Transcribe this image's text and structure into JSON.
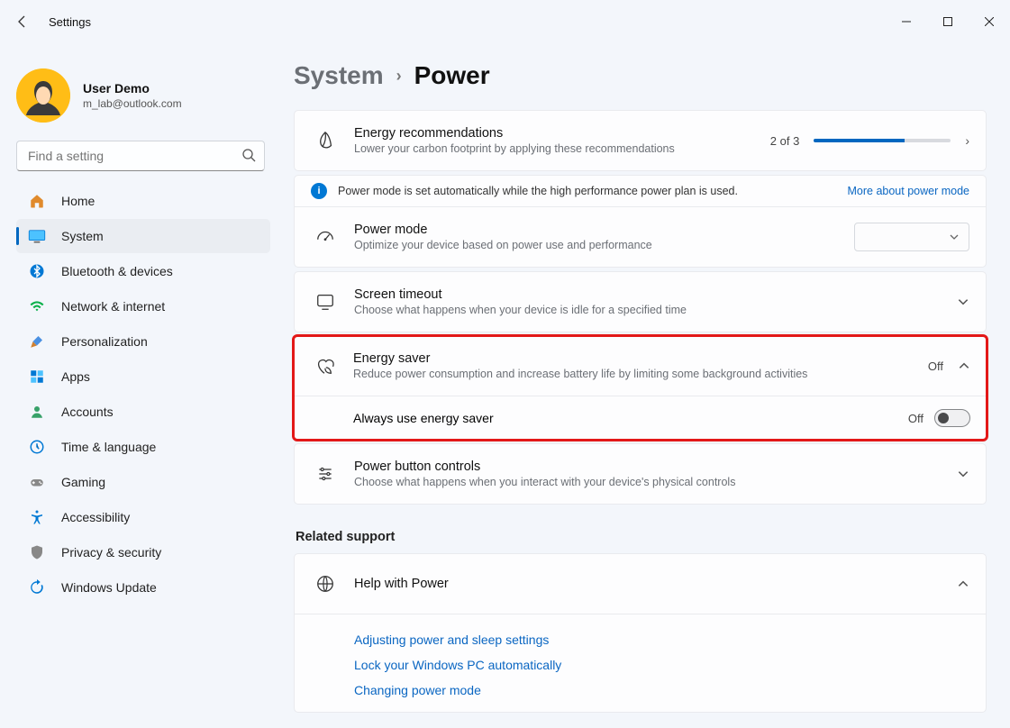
{
  "window": {
    "title": "Settings"
  },
  "user": {
    "name": "User Demo",
    "email": "m_lab@outlook.com"
  },
  "search": {
    "placeholder": "Find a setting"
  },
  "nav": [
    {
      "icon": "home",
      "label": "Home"
    },
    {
      "icon": "system",
      "label": "System",
      "selected": true
    },
    {
      "icon": "bluetooth",
      "label": "Bluetooth & devices"
    },
    {
      "icon": "network",
      "label": "Network & internet"
    },
    {
      "icon": "personalization",
      "label": "Personalization"
    },
    {
      "icon": "apps",
      "label": "Apps"
    },
    {
      "icon": "accounts",
      "label": "Accounts"
    },
    {
      "icon": "time",
      "label": "Time & language"
    },
    {
      "icon": "gaming",
      "label": "Gaming"
    },
    {
      "icon": "accessibility",
      "label": "Accessibility"
    },
    {
      "icon": "privacy",
      "label": "Privacy & security"
    },
    {
      "icon": "update",
      "label": "Windows Update"
    }
  ],
  "breadcrumb": {
    "parent": "System",
    "current": "Power"
  },
  "energy": {
    "title": "Energy recommendations",
    "sub": "Lower your carbon footprint by applying these recommendations",
    "count": "2 of 3",
    "progress_pct": 66
  },
  "info": {
    "text": "Power mode is set automatically while the high performance power plan is used.",
    "link": "More about power mode"
  },
  "powermode": {
    "title": "Power mode",
    "sub": "Optimize your device based on power use and performance",
    "selected": ""
  },
  "screen": {
    "title": "Screen timeout",
    "sub": "Choose what happens when your device is idle for a specified time"
  },
  "saver": {
    "title": "Energy saver",
    "sub": "Reduce power consumption and increase battery life by limiting some background activities",
    "state": "Off",
    "always_label": "Always use energy saver",
    "always_state": "Off"
  },
  "pbc": {
    "title": "Power button controls",
    "sub": "Choose what happens when you interact with your device's physical controls"
  },
  "related": {
    "heading": "Related support",
    "help_title": "Help with Power",
    "links": [
      "Adjusting power and sleep settings",
      "Lock your Windows PC automatically",
      "Changing power mode"
    ]
  }
}
